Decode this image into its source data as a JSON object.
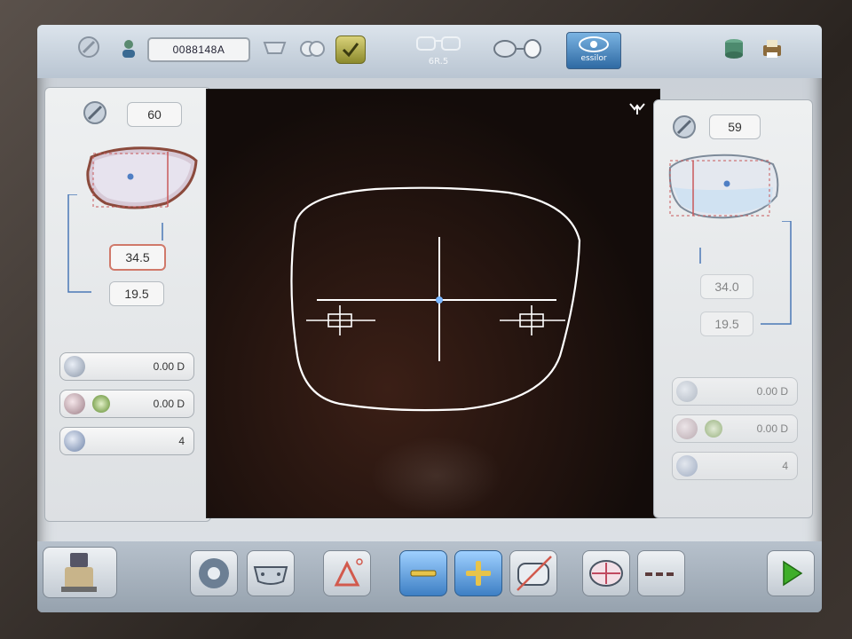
{
  "topbar": {
    "job_number": "0088148A",
    "frame_label": "6R.5",
    "brand_label": "essilor"
  },
  "left_lens": {
    "diameter": "60",
    "half_pd": "34.5",
    "height": "19.5",
    "rows": [
      {
        "icon": "lens-power-icon",
        "value": "0.00 D"
      },
      {
        "icon": "cylinder-axis-icon",
        "value": "0.00 D"
      },
      {
        "icon": "base-curve-icon",
        "value": "4"
      }
    ]
  },
  "right_lens": {
    "diameter": "59",
    "half_pd": "34.0",
    "height": "19.5",
    "rows": [
      {
        "icon": "lens-power-icon",
        "value": "0.00 D"
      },
      {
        "icon": "cylinder-axis-icon",
        "value": "0.00 D"
      },
      {
        "icon": "base-curve-icon",
        "value": "4"
      }
    ]
  },
  "viewport": {
    "lens_shape": "rounded-rectangle",
    "marker_icon": "glasses-frame-icon"
  },
  "bottombar": {
    "buttons": [
      "machine-icon",
      "lens-icon",
      "frame-shape-icon",
      "triangle-icon",
      "minus-icon",
      "plus-icon",
      "no-shape-icon",
      "target-icon",
      "dash-icon",
      "next-arrow-icon"
    ]
  },
  "colors": {
    "accent_blue": "#3d7fc4",
    "highlight_red": "#d0796a",
    "viewport_bg": "#130c0a",
    "lens_outline": "#ffffff",
    "next_green": "#3fae2a"
  }
}
